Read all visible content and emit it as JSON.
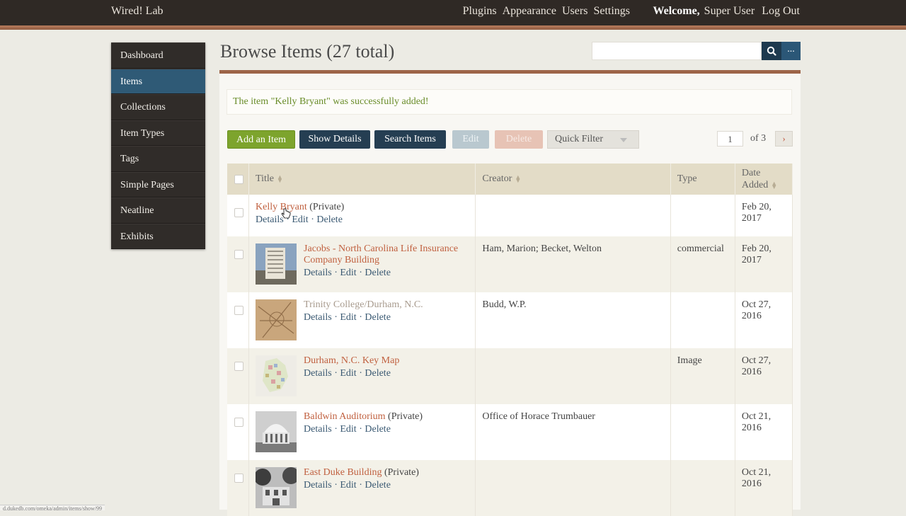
{
  "site": {
    "title": "Wired! Lab"
  },
  "nav": {
    "items": [
      "Plugins",
      "Appearance",
      "Users",
      "Settings"
    ]
  },
  "user": {
    "welcome": "Welcome,",
    "name": "Super User",
    "logout": "Log Out"
  },
  "sidebar": {
    "items": [
      "Dashboard",
      "Items",
      "Collections",
      "Item Types",
      "Tags",
      "Simple Pages",
      "Neatline",
      "Exhibits"
    ],
    "active": "Items"
  },
  "page": {
    "title": "Browse Items (27 total)"
  },
  "search": {
    "more_label": "..."
  },
  "flash": {
    "message": "The item \"Kelly Bryant\" was successfully added!"
  },
  "toolbar": {
    "add": "Add an Item",
    "show_details": "Show Details",
    "search_items": "Search Items",
    "edit": "Edit",
    "delete": "Delete",
    "quick_filter": "Quick Filter"
  },
  "pagination": {
    "current": "1",
    "of_label": "of 3",
    "next": "›"
  },
  "table": {
    "headers": {
      "title": "Title",
      "creator": "Creator",
      "type": "Type",
      "date_added_1": "Date",
      "date_added_2": "Added"
    },
    "action_labels": {
      "details": "Details",
      "edit": "Edit",
      "delete": "Delete",
      "sep": "·"
    },
    "rows": [
      {
        "title": "Kelly Bryant",
        "private": "(Private)",
        "creator": "",
        "type": "",
        "date_1": "Feb 20,",
        "date_2": "2017"
      },
      {
        "title": "Jacobs - North Carolina Life Insurance Company Building",
        "private": "",
        "creator": "Ham, Marion; Becket, Welton",
        "type": "commercial",
        "date_1": "Feb 20,",
        "date_2": "2017"
      },
      {
        "title": "Trinity College/Durham, N.C.",
        "private": "",
        "creator": "Budd, W.P.",
        "type": "",
        "date_1": "Oct 27,",
        "date_2": "2016"
      },
      {
        "title": "Durham, N.C. Key Map",
        "private": "",
        "creator": "",
        "type": "Image",
        "date_1": "Oct 27,",
        "date_2": "2016"
      },
      {
        "title": "Baldwin Auditorium",
        "private": "(Private)",
        "creator": "Office of Horace Trumbauer",
        "type": "",
        "date_1": "Oct 21,",
        "date_2": "2016"
      },
      {
        "title": "East Duke Building",
        "private": "(Private)",
        "creator": "",
        "type": "",
        "date_1": "Oct 21,",
        "date_2": "2016"
      }
    ]
  },
  "status_bar": {
    "url": "d.dukedb.com/omeka/admin/items/show/99"
  },
  "colors": {
    "accent": "#c0603f",
    "nav_dark": "#302c29",
    "active_blue": "#2f5a76",
    "add_green": "#7da42d"
  }
}
